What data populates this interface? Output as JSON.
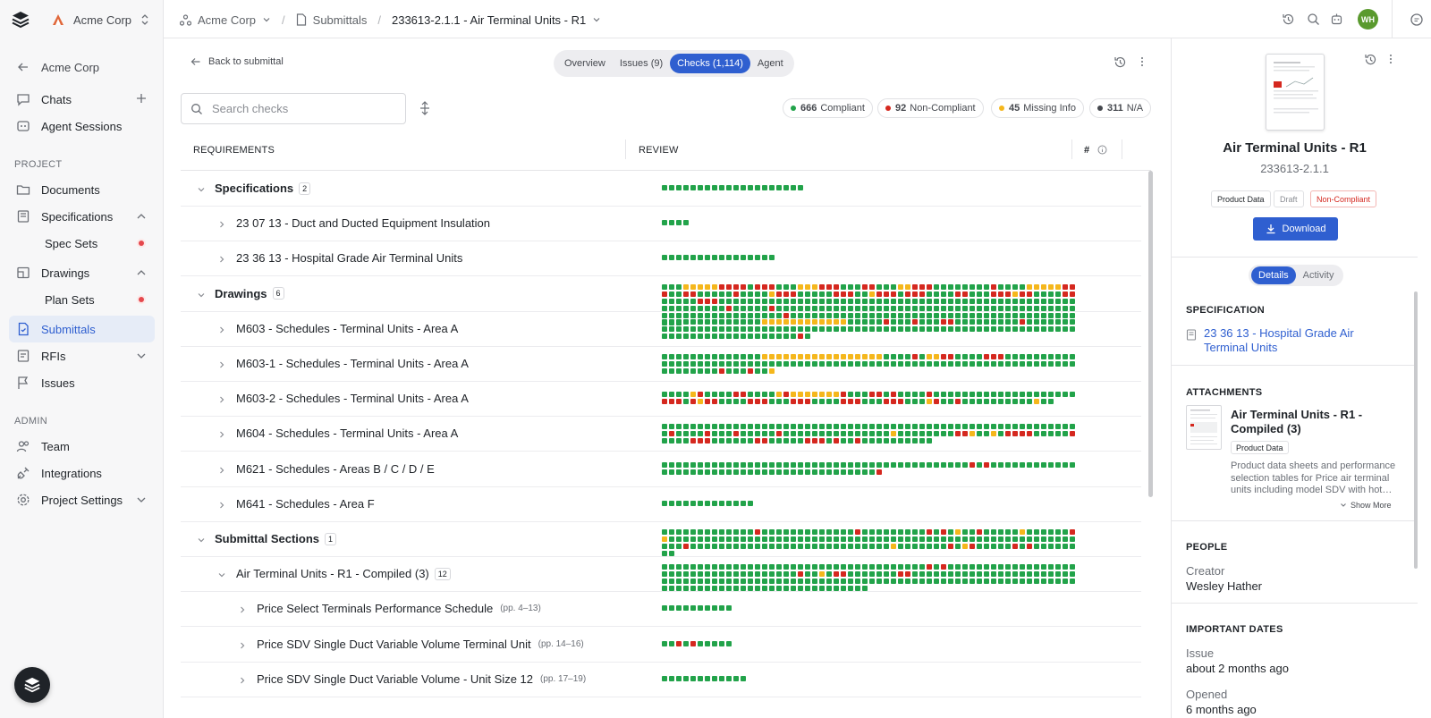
{
  "colors": {
    "green": "#22a34a",
    "yellow": "#f5b71c",
    "red": "#d5281f",
    "gray": "#45484e",
    "accent": "#2f5fd0"
  },
  "sidebar": {
    "org_name": "Acme Corp",
    "back_label": "Acme Corp",
    "chats": "Chats",
    "agent_sessions": "Agent Sessions",
    "project_section": "PROJECT",
    "documents": "Documents",
    "specifications": "Specifications",
    "spec_sets": "Spec Sets",
    "drawings": "Drawings",
    "plan_sets": "Plan Sets",
    "submittals": "Submittals",
    "rfis": "RFIs",
    "issues": "Issues",
    "admin_section": "ADMIN",
    "team": "Team",
    "integrations": "Integrations",
    "project_settings": "Project Settings"
  },
  "topbar": {
    "org": "Acme Corp",
    "section": "Submittals",
    "current": "233613-2.1.1 - Air Terminal Units - R1",
    "avatar": "WH"
  },
  "main": {
    "back": "Back to submittal",
    "tabs": [
      "Overview",
      "Issues (9)",
      "Checks (1,114)",
      "Agent"
    ],
    "search_placeholder": "Search checks",
    "stats": [
      {
        "count": "666",
        "label": "Compliant",
        "color": "green"
      },
      {
        "count": "92",
        "label": "Non-Compliant",
        "color": "red"
      },
      {
        "count": "45",
        "label": "Missing Info",
        "color": "yellow"
      },
      {
        "count": "311",
        "label": "N/A",
        "color": "gray"
      }
    ],
    "col_requirements": "REQUIREMENTS",
    "col_review": "REVIEW",
    "col_hash": "#"
  },
  "rows": [
    {
      "label": "Specifications",
      "count": "2",
      "level": 0,
      "expanded": true,
      "bold": true,
      "cells": "G20"
    },
    {
      "label": "23 07 13 - Duct and Ducted Equipment Insulation",
      "level": 1,
      "cells": "G4"
    },
    {
      "label": "23 36 13 - Hospital Grade Air Terminal Units",
      "level": 1,
      "cells": "G16"
    },
    {
      "label": "Drawings",
      "count": "6",
      "level": 0,
      "expanded": true,
      "bold": true,
      "cells": "G3Y5R4G1R3G3Y3R3G3R2G3Y2R3G8R1G4Y5R3G2R2G5R1G4Y1R3G5R3G1G1Y1R3G1R3G4R2G3R3Y1R2G4R2G5R3G3G39G10G7R1G5R1G3G10G10G4G4G10G10G8R1G25G10G8"
    },
    {
      "label": "M603 - Schedules - Terminal Units - Area A",
      "level": 1,
      "cells": "G14Y12G5R1G3R1G3R2G9R1G18G46G20R1G1"
    },
    {
      "label": "M603-1 - Schedules - Terminal Units - Area A",
      "level": 1,
      "cells": "G14Y17G4R1G1Y2R2G4R3G10G46G20R1G3R1G2Y1"
    },
    {
      "label": "M603-2 - Schedules - Terminal Units - Area A",
      "level": 1,
      "cells": "G4Y1R1G4R2G4Y1R1Y7R1G3R2G1R1G3G1R1G18G2R3G1R1Y1R2G4R3G3R3G4R3G3R3G3Y1R1G2R1G1G9Y1G2"
    },
    {
      "label": "M604 - Schedules - Terminal Units - Area A",
      "level": 1,
      "cells": "G58G1R1G4R1G3R1G5R1G11G4Y1G8R2Y1G2Y1G1R1R3G5R1G4R3G6R2G5R3G1R1G2R1G10"
    },
    {
      "label": "M621 - Schedules - Areas B / C / D / E",
      "level": 1,
      "cells": "G43R1G1R1G12G30R1"
    },
    {
      "label": "M641 - Schedules - Area F",
      "level": 1,
      "cells": "G13"
    },
    {
      "label": "Submittal Sections",
      "count": "1",
      "level": 0,
      "expanded": true,
      "bold": true,
      "cells": "G13R1G13R1G9R1G1R1G1Y1G2R1G5Y1G6R1Y1G5G46G9R1G28Y1G7R1G1Y1R1G5R1G1R1G7G1"
    },
    {
      "label": "Air Terminal Units - R1 - Compiled (3)",
      "count": "12",
      "level": 1,
      "expanded": true,
      "cells": "G37R1G1R1G37R1G2Y1G1R2G7R2G6G46G57G1"
    },
    {
      "label": "Price Select Terminals Performance Schedule",
      "pages": "(pp. 4–13)",
      "level": 2,
      "cells": "G10"
    },
    {
      "label": "Price SDV Single Duct Variable Volume Terminal Unit",
      "pages": "(pp. 14–16)",
      "level": 2,
      "cells": "G2R1G1R1G5"
    },
    {
      "label": "Price SDV Single Duct Variable Volume - Unit Size 12",
      "pages": "(pp. 17–19)",
      "level": 2,
      "cells": "G12"
    }
  ],
  "panel": {
    "title": "Air Terminal Units - R1",
    "code": "233613-2.1.1",
    "badges": [
      "Product Data",
      "Draft",
      "Non-Compliant"
    ],
    "download": "Download",
    "tabs": [
      "Details",
      "Activity"
    ],
    "spec_title": "SPECIFICATION",
    "spec_link": "23 36 13 - Hospital Grade Air Terminal Units",
    "attach_title": "ATTACHMENTS",
    "attach_name": "Air Terminal Units - R1 - Compiled (3)",
    "attach_badge": "Product Data",
    "attach_desc": "Product data sheets and performance selection tables for Price air terminal units including model SDV with hot…",
    "show_more": "Show More",
    "people_title": "PEOPLE",
    "creator_label": "Creator",
    "creator_name": "Wesley Hather",
    "dates_title": "IMPORTANT DATES",
    "issue_label": "Issue",
    "issue_value": "about 2 months ago",
    "opened_label": "Opened",
    "opened_value": "6 months ago"
  }
}
